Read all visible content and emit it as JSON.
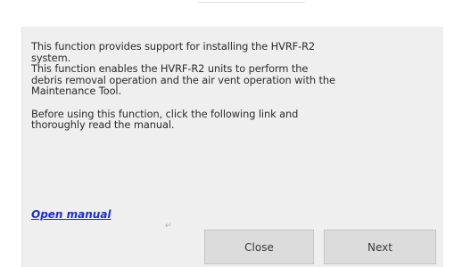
{
  "dialog": {
    "message_lines": [
      "This function provides support for installing the HVRF-R2",
      "system.",
      "This function  enables the HVRF-R2 units to perform the",
      "debris removal operation and the air vent operation with the",
      "Maintenance Tool."
    ],
    "message_lines_2": [
      "Before using this function, click the following link and",
      "thoroughly read the manual."
    ],
    "link_label": "Open manual",
    "return_mark": "↵",
    "buttons": {
      "close_label": "Close",
      "next_label": "Next"
    }
  },
  "colors": {
    "panel_bg": "#efefef",
    "link": "#1a2fd6",
    "button_bg": "#dcdcdc"
  }
}
